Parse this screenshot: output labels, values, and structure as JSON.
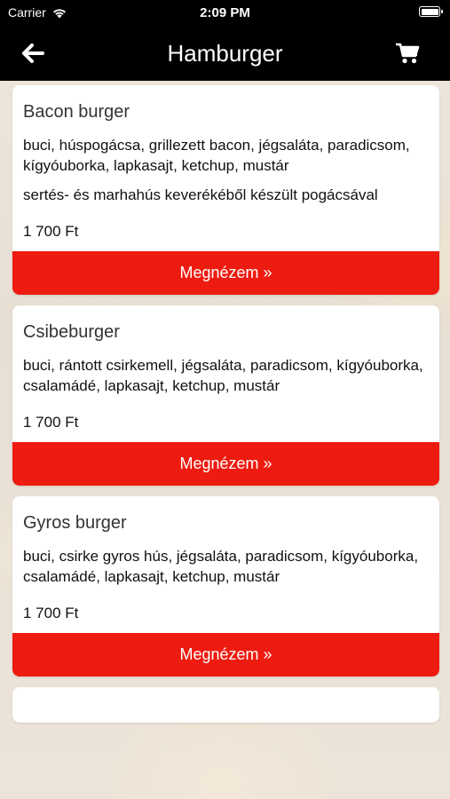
{
  "status_bar": {
    "carrier": "Carrier",
    "time": "2:09 PM"
  },
  "header": {
    "title": "Hamburger",
    "back_icon": "arrow-left-icon",
    "cart_icon": "cart-icon"
  },
  "products": [
    {
      "name": "Bacon burger",
      "description": "buci, húspogácsa, grillezett bacon, jégsaláta, paradicsom, kígyóuborka, lapkasajt, ketchup, mustár",
      "note": "sertés- és marhahús keverékéből készült pogácsával",
      "price": "1 700 Ft",
      "button": "Megnézem »"
    },
    {
      "name": "Csibeburger",
      "description": "buci, rántott csirkemell, jégsaláta, paradicsom, kígyóuborka, csalamádé, lapkasajt, ketchup, mustár",
      "price": "1 700 Ft",
      "button": "Megnézem »"
    },
    {
      "name": "Gyros burger",
      "description": "buci, csirke gyros hús, jégsaláta, paradicsom, kígyóuborka, csalamádé, lapkasajt, ketchup, mustár",
      "price": "1 700 Ft",
      "button": "Megnézem »"
    }
  ],
  "colors": {
    "nav": "#000000",
    "button": "#ee1b10",
    "card": "#ffffff"
  }
}
